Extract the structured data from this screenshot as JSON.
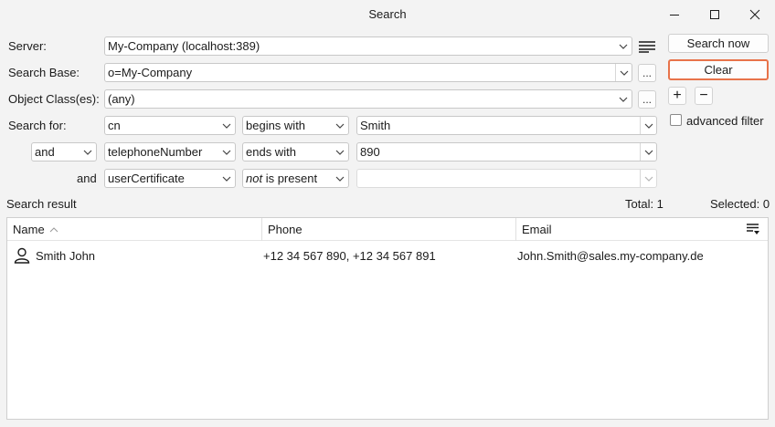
{
  "window": {
    "title": "Search",
    "minimize_icon": "minimize-icon",
    "maximize_icon": "maximize-icon",
    "close_icon": "close-icon"
  },
  "form": {
    "server_label": "Server:",
    "server_value": "My-Company (localhost:389)",
    "search_base_label": "Search Base:",
    "search_base_value": "o=My-Company",
    "object_class_label": "Object Class(es):",
    "object_class_value": "(any)",
    "search_for_label": "Search for:",
    "ellipsis": "...",
    "filters": [
      {
        "connector": "",
        "attribute": "cn",
        "operator_em": "",
        "operator": "begins with",
        "value": "Smith"
      },
      {
        "connector": "and",
        "attribute": "telephoneNumber",
        "operator_em": "",
        "operator": "ends with",
        "value": "890"
      },
      {
        "connector": "and",
        "attribute": "userCertificate",
        "operator_em": "not",
        "operator": " is present",
        "value": ""
      }
    ]
  },
  "actions": {
    "search_now": "Search now",
    "clear": "Clear",
    "add": "+",
    "remove": "−",
    "advanced_filter_label": "advanced filter",
    "advanced_filter_checked": false
  },
  "results": {
    "label": "Search result",
    "total": "Total: 1",
    "selected": "Selected: 0",
    "columns": [
      "Name",
      "Phone",
      "Email"
    ],
    "sort_column": "Name",
    "rows": [
      {
        "icon": "person-icon",
        "name": "Smith John",
        "phone": "+12 34 567 890, +12 34 567 891",
        "email": "John.Smith@sales.my-company.de"
      }
    ]
  },
  "colors": {
    "accent": "#e8734a",
    "background": "#f3f3f3"
  }
}
